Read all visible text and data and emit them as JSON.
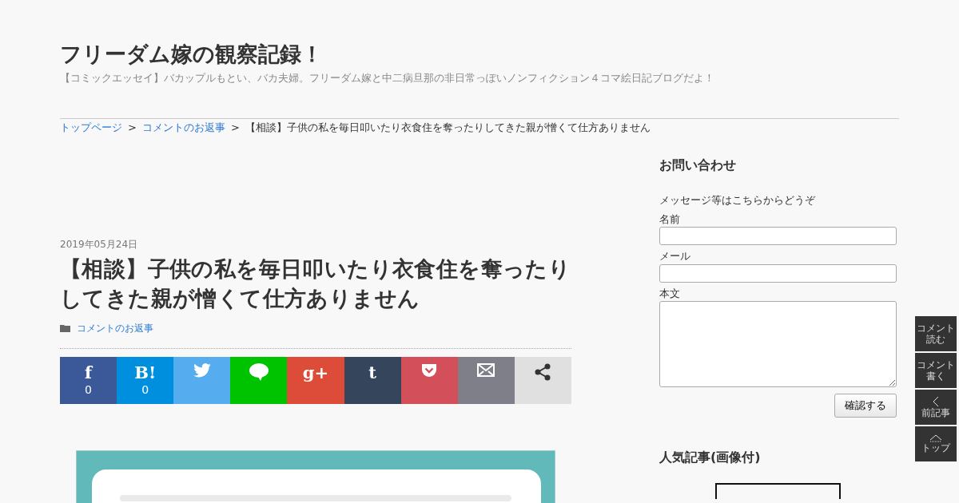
{
  "site": {
    "title": "フリーダム嫁の観察記録！",
    "tagline": "【コミックエッセイ】バカップルもとい、バカ夫婦。フリーダム嫁と中二病旦那の非日常っぽいノンフィクション４コマ絵日記ブログだよ！"
  },
  "breadcrumb": [
    {
      "label": "トップページ",
      "link": true
    },
    {
      "label": "コメントのお返事",
      "link": true
    },
    {
      "label": "【相談】子供の私を毎日叩いたり衣食住を奪ったりしてきた親が憎くて仕方ありません",
      "link": false
    }
  ],
  "breadcrumb_separator": ">",
  "article": {
    "date": "2019年05月24日",
    "title": "【相談】子供の私を毎日叩いたり衣食住を奪ったりしてきた親が憎くて仕方ありません",
    "category": "コメントのお返事"
  },
  "share_buttons": [
    {
      "kind": "facebook",
      "glyph": "f",
      "count": "0",
      "color": "#3b5998"
    },
    {
      "kind": "hatena",
      "glyph": "B!",
      "count": "0",
      "color": "#008fde"
    },
    {
      "kind": "twitter",
      "color": "#55acee"
    },
    {
      "kind": "line",
      "color": "#00c300"
    },
    {
      "kind": "googleplus",
      "glyph": "g+",
      "color": "#dd4b39"
    },
    {
      "kind": "tumblr",
      "glyph": "t",
      "color": "#35465c"
    },
    {
      "kind": "pocket",
      "color": "#d3505a"
    },
    {
      "kind": "mail",
      "color": "#7f7f8a"
    },
    {
      "kind": "share",
      "color": "#e0e0e0"
    }
  ],
  "sidebar": {
    "contact": {
      "heading": "お問い合わせ",
      "intro": "メッセージ等はこちらからどうぞ",
      "fields": [
        {
          "label": "名前",
          "kind": "text"
        },
        {
          "label": "メール",
          "kind": "text"
        },
        {
          "label": "本文",
          "kind": "textarea"
        }
      ],
      "submit": "確認する"
    },
    "popular_heading": "人気記事(画像付)"
  },
  "floating_buttons": [
    {
      "kind": "text",
      "lines": [
        "コメント",
        "読む"
      ]
    },
    {
      "kind": "text",
      "lines": [
        "コメント",
        "書く"
      ]
    },
    {
      "kind": "prev",
      "lines": [
        "前記事"
      ]
    },
    {
      "kind": "top",
      "lines": [
        "トップ"
      ]
    }
  ]
}
